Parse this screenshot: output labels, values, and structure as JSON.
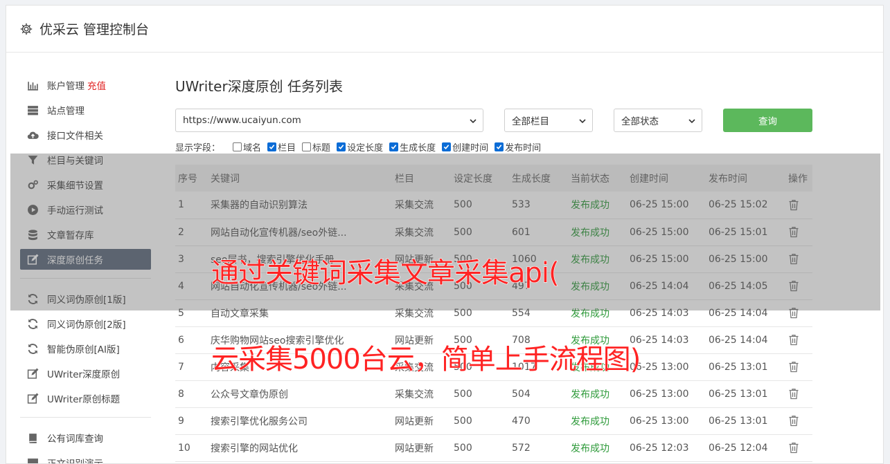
{
  "app": {
    "title": "优采云 管理控制台"
  },
  "sidebar": {
    "items": [
      {
        "label": "账户管理",
        "extra": "充值",
        "icon": "bar-chart-icon"
      },
      {
        "label": "站点管理",
        "icon": "server-icon"
      },
      {
        "label": "接口文件相关",
        "icon": "cloud-upload-icon"
      },
      {
        "label": "栏目与关键词",
        "icon": "filter-icon"
      },
      {
        "label": "采集细节设置",
        "icon": "gears-icon"
      },
      {
        "label": "手动运行测试",
        "icon": "play-circle-icon"
      },
      {
        "label": "文章暂存库",
        "icon": "database-icon"
      },
      {
        "label": "深度原创任务",
        "icon": "edit-icon",
        "active": true
      },
      {
        "label": "同义词伪原创[1版]",
        "icon": "refresh-icon"
      },
      {
        "label": "同义词伪原创[2版]",
        "icon": "refresh-icon"
      },
      {
        "label": "智能伪原创[AI版]",
        "icon": "refresh-icon"
      },
      {
        "label": "UWriter深度原创",
        "icon": "edit-icon"
      },
      {
        "label": "UWriter原创标题",
        "icon": "edit-icon"
      },
      {
        "label": "公有词库查询",
        "icon": "book-icon"
      },
      {
        "label": "正文识别演示",
        "icon": "monitor-icon"
      }
    ]
  },
  "main": {
    "title": "UWriter深度原创 任务列表",
    "filters": {
      "site": "https://www.ucaiyun.com",
      "column": "全部栏目",
      "status": "全部状态",
      "query_label": "查询"
    },
    "fields_label": "显示字段：",
    "fields": [
      {
        "label": "域名",
        "checked": false
      },
      {
        "label": "栏目",
        "checked": true
      },
      {
        "label": "标题",
        "checked": false
      },
      {
        "label": "设定长度",
        "checked": true
      },
      {
        "label": "生成长度",
        "checked": true
      },
      {
        "label": "创建时间",
        "checked": true
      },
      {
        "label": "发布时间",
        "checked": true
      }
    ],
    "table": {
      "headers": [
        "序号",
        "关键词",
        "栏目",
        "设定长度",
        "生成长度",
        "当前状态",
        "创建时间",
        "发布时间",
        "操作"
      ],
      "rows": [
        [
          "1",
          "采集器的自动识别算法",
          "采集交流",
          "500",
          "533",
          "发布成功",
          "06-25 15:00",
          "06-25 15:02"
        ],
        [
          "2",
          "网站自动化宣传机器/seo外链...",
          "采集交流",
          "500",
          "601",
          "发布成功",
          "06-25 15:00",
          "06-25 15:01"
        ],
        [
          "3",
          "seo层书，搜索引擎优化手册",
          "网站更新",
          "500",
          "1060",
          "发布成功",
          "06-25 15:00",
          "06-25 15:00"
        ],
        [
          "4",
          "网站自动化宣传机器/seo外链...",
          "采集交流",
          "500",
          "497",
          "发布成功",
          "06-25 14:04",
          "06-25 14:05"
        ],
        [
          "5",
          "自动文章采集",
          "采集交流",
          "500",
          "554",
          "发布成功",
          "06-25 14:03",
          "06-25 14:04"
        ],
        [
          "6",
          "庆华购物网站seo搜索引擎优化",
          "网站更新",
          "500",
          "708",
          "发布成功",
          "06-25 14:03",
          "06-25 14:04"
        ],
        [
          "7",
          "内容采集",
          "采集交流",
          "500",
          "1017",
          "发布成功",
          "06-25 13:00",
          "06-25 13:01"
        ],
        [
          "8",
          "公众号文章伪原创",
          "采集交流",
          "500",
          "504",
          "发布成功",
          "06-25 13:00",
          "06-25 13:01"
        ],
        [
          "9",
          "搜索引擎优化服务公司",
          "网站更新",
          "500",
          "470",
          "发布成功",
          "06-25 13:00",
          "06-25 13:01"
        ],
        [
          "10",
          "搜索引擎的网站优化",
          "网站更新",
          "500",
          "572",
          "发布成功",
          "06-25 12:03",
          "06-25 12:04"
        ]
      ]
    }
  },
  "overlay": {
    "line1": "通过关键词采集文章采集api(",
    "line2": "云采集5000台云，简单上手流程图)"
  },
  "colors": {
    "active_nav": "#5f6b7e",
    "query_button": "#5cb85c",
    "success": "#2e9a3a",
    "recharge": "#e02020",
    "watermark": "#ff2323"
  }
}
